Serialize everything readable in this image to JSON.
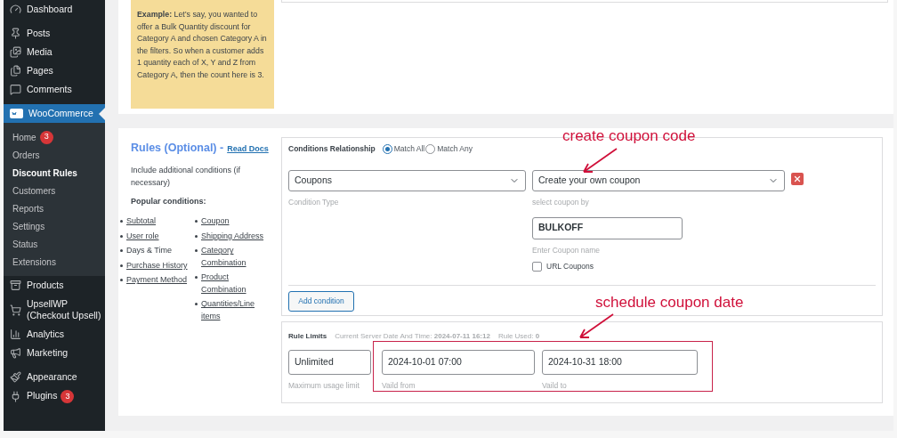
{
  "sidebar": {
    "groups": [
      [
        {
          "label": "Dashboard",
          "selected": false
        }
      ],
      [
        {
          "label": "Posts",
          "selected": false
        },
        {
          "label": "Media",
          "selected": false
        },
        {
          "label": "Pages",
          "selected": false
        },
        {
          "label": "Comments",
          "selected": false
        }
      ],
      [
        {
          "label": "WooCommerce",
          "selected": true,
          "children": [
            {
              "label": "Home",
              "badge": "3",
              "selected": false
            },
            {
              "label": "Orders",
              "selected": false
            },
            {
              "label": "Discount Rules",
              "selected": true
            },
            {
              "label": "Customers",
              "selected": false
            },
            {
              "label": "Reports",
              "selected": false
            },
            {
              "label": "Settings",
              "selected": false
            },
            {
              "label": "Status",
              "selected": false
            },
            {
              "label": "Extensions",
              "selected": false
            }
          ]
        },
        {
          "label": "Products",
          "selected": false
        },
        {
          "label": "UpsellWP (Checkout Upsell)",
          "selected": false
        },
        {
          "label": "Analytics",
          "selected": false
        },
        {
          "label": "Marketing",
          "selected": false
        }
      ],
      [
        {
          "label": "Appearance",
          "selected": false
        },
        {
          "label": "Plugins",
          "badge": "3",
          "selected": false
        }
      ]
    ]
  },
  "example_note": "**Example:** Let’s say, you wanted to offer a Bulk Quantity discount for Category A and chosen Category A in the filters. So when a customer adds 1 quantity each of X, Y and Z from Category A, then the count here is 3.",
  "rules": {
    "title": "Rules (Optional) -",
    "docs_link": "Read Docs",
    "description": "Include additional conditions (if necessary)",
    "popular_heading": "Popular conditions:",
    "columns": [
      [
        {
          "label": "Subtotal",
          "kind": "link"
        },
        {
          "label": "User role",
          "kind": "link"
        },
        {
          "label": "Days & Time",
          "kind": "text"
        },
        {
          "label": "Purchase History",
          "kind": "link"
        },
        {
          "label": "Payment Method",
          "kind": "link"
        }
      ],
      [
        {
          "label": "Coupon",
          "kind": "link"
        },
        {
          "label": "Shipping Address",
          "kind": "link"
        },
        {
          "label": "Category Combination",
          "kind": "link"
        },
        {
          "label": "Product Combination",
          "kind": "link"
        },
        {
          "label": "Quantities/Line items",
          "kind": "link"
        }
      ]
    ]
  },
  "conditions": {
    "relationship_label": "Conditions Relationship",
    "options": [
      {
        "label": "Match All",
        "selected": true
      },
      {
        "label": "Match Any",
        "selected": false
      }
    ],
    "type_select": {
      "value": "Coupons",
      "helper": "Condition Type"
    },
    "coupon_select": {
      "value": "Create your own coupon",
      "helper": "select coupon by"
    },
    "coupon_name": {
      "value": "BULKOFF",
      "helper": "Enter Coupon name"
    },
    "url_coupons": {
      "label": "URL Coupons",
      "checked": false
    },
    "add_button": "Add condition"
  },
  "rule_limits": {
    "label": "Rule Limits",
    "server_time": "Current Server Date And Time: **2024-07-11 16:12**",
    "rule_used": "Rule Used: **0**",
    "fields": [
      {
        "value": "Unlimited",
        "helper": "Maximum usage limit"
      },
      {
        "value": "2024-10-01 07:00",
        "helper": "Vaild from"
      },
      {
        "value": "2024-10-31 18:00",
        "helper": "Vaild to"
      }
    ]
  },
  "annotations": [
    {
      "text": "create coupon code"
    },
    {
      "text": "schedule coupon date"
    }
  ]
}
